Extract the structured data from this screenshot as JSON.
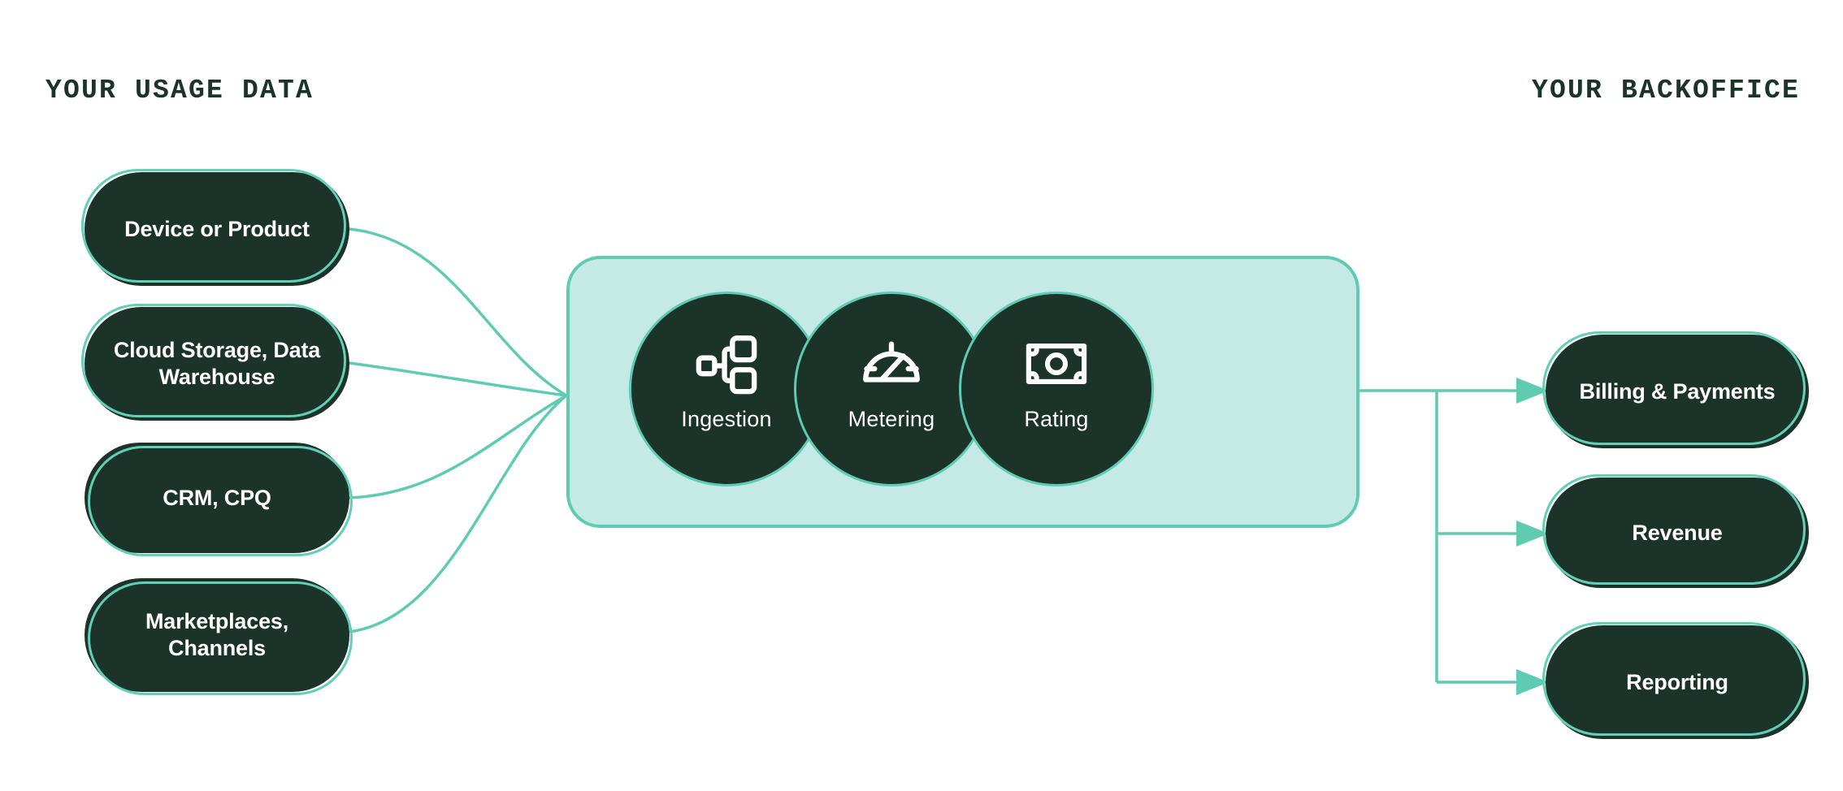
{
  "headings": {
    "left": "YOUR USAGE DATA",
    "right": "YOUR BACKOFFICE"
  },
  "colors": {
    "dark_green": "#1c3329",
    "mint_accent": "#5fccb2",
    "panel_fill": "#c5e9e4",
    "white": "#ffffff",
    "background": "#ffffff"
  },
  "sources": [
    {
      "id": "device-or-product",
      "label": "Device or Product"
    },
    {
      "id": "cloud-storage-data-warehouse",
      "label": "Cloud Storage, Data Warehouse"
    },
    {
      "id": "crm-cpq",
      "label": "CRM, CPQ"
    },
    {
      "id": "marketplaces-channels",
      "label": "Marketplaces, Channels"
    }
  ],
  "pipeline": {
    "stages": [
      {
        "id": "ingestion",
        "label": "Ingestion",
        "icon": "sitemap-icon"
      },
      {
        "id": "metering",
        "label": "Metering",
        "icon": "gauge-icon"
      },
      {
        "id": "rating",
        "label": "Rating",
        "icon": "banknote-icon"
      }
    ]
  },
  "destinations": [
    {
      "id": "billing-and-payments",
      "label": "Billing & Payments"
    },
    {
      "id": "revenue",
      "label": "Revenue"
    },
    {
      "id": "reporting",
      "label": "Reporting"
    }
  ]
}
